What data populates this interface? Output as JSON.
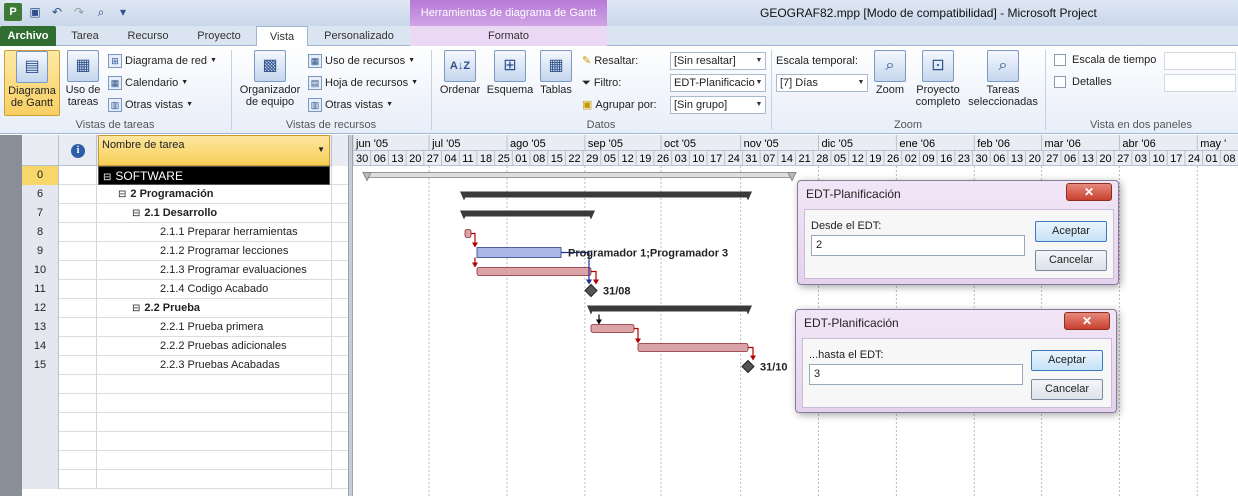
{
  "window": {
    "contextual_title": "Herramientas de diagrama de Gantt",
    "title": "GEOGRAF82.mpp [Modo de compatibilidad] - Microsoft Project"
  },
  "tabs": [
    {
      "label": "Archivo"
    },
    {
      "label": "Tarea"
    },
    {
      "label": "Recurso"
    },
    {
      "label": "Proyecto"
    },
    {
      "label": "Vista"
    },
    {
      "label": "Personalizado"
    },
    {
      "label": "Formato"
    }
  ],
  "ribbon": {
    "task_views": {
      "group_label": "Vistas de tareas",
      "gantt_label1": "Diagrama",
      "gantt_label2": "de Gantt",
      "usage_label1": "Uso de",
      "usage_label2": "tareas",
      "network": "Diagrama de red",
      "calendar": "Calendario",
      "other": "Otras vistas"
    },
    "resource_views": {
      "group_label": "Vistas de recursos",
      "team_label1": "Organizador",
      "team_label2": "de equipo",
      "usage": "Uso de recursos",
      "sheet": "Hoja de recursos",
      "other": "Otras vistas"
    },
    "data": {
      "group_label": "Datos",
      "sort": "Ordenar",
      "outline": "Esquema",
      "tables": "Tablas",
      "highlight_label": "Resaltar:",
      "highlight_value": "[Sin resaltar]",
      "filter_label": "Filtro:",
      "filter_value": "EDT-Planificacio",
      "group_label_text": "Agrupar por:",
      "group_value": "[Sin grupo]"
    },
    "zoom": {
      "group_label": "Zoom",
      "timescale_label": "Escala temporal:",
      "timescale_value": "[7] Días",
      "zoom": "Zoom",
      "entire1": "Proyecto",
      "entire2": "completo",
      "selected1": "Tareas",
      "selected2": "seleccionadas"
    },
    "split": {
      "group_label": "Vista en dos paneles",
      "timeline": "Escala de tiempo",
      "details": "Detalles"
    }
  },
  "grid": {
    "header": "Nombre de tarea",
    "rows": [
      {
        "id": "0",
        "name": "SOFTWARE"
      },
      {
        "id": "6",
        "name": "2 Programación"
      },
      {
        "id": "7",
        "name": "2.1 Desarrollo"
      },
      {
        "id": "8",
        "name": "2.1.1 Preparar herramientas"
      },
      {
        "id": "9",
        "name": "2.1.2 Programar lecciones"
      },
      {
        "id": "10",
        "name": "2.1.3 Programar evaluaciones"
      },
      {
        "id": "11",
        "name": "2.1.4 Codigo Acabado"
      },
      {
        "id": "12",
        "name": "2.2 Prueba"
      },
      {
        "id": "13",
        "name": "2.2.1 Prueba primera"
      },
      {
        "id": "14",
        "name": "2.2.2 Pruebas adicionales"
      },
      {
        "id": "15",
        "name": "2.2.3 Pruebas Acabadas"
      }
    ]
  },
  "timescale": {
    "months": [
      "jun '05",
      "jul '05",
      "ago '05",
      "sep '05",
      "oct '05",
      "nov '05",
      "dic '05",
      "ene '06",
      "feb '06",
      "mar '06",
      "abr '06",
      "may '"
    ],
    "days": [
      "30",
      "06",
      "13",
      "20",
      "27",
      "04",
      "11",
      "18",
      "25",
      "01",
      "08",
      "15",
      "22",
      "29",
      "05",
      "12",
      "19",
      "26",
      "03",
      "10",
      "17",
      "24",
      "31",
      "07",
      "14",
      "21",
      "28",
      "05",
      "12",
      "19",
      "26",
      "02",
      "09",
      "16",
      "23",
      "30",
      "06",
      "13",
      "20",
      "27",
      "06",
      "13",
      "20",
      "27",
      "03",
      "10",
      "17",
      "24",
      "01",
      "08"
    ]
  },
  "chart_labels": {
    "resources": "Programador 1;Programador 3",
    "milestone1": "31/08",
    "milestone2": "31/10"
  },
  "dialog1": {
    "title": "EDT-Planificación",
    "label": "Desde el EDT:",
    "value": "2",
    "ok": "Aceptar",
    "cancel": "Cancelar"
  },
  "dialog2": {
    "title": "EDT-Planificación",
    "label": "...hasta el EDT:",
    "value": "3",
    "ok": "Aceptar",
    "cancel": "Cancelar"
  },
  "colors": {
    "summary_bar": "#3a3a3a",
    "task_bar": "#d9a3a8",
    "task_bar_blue": "#a9b8e6",
    "arrow": "#b00000"
  }
}
